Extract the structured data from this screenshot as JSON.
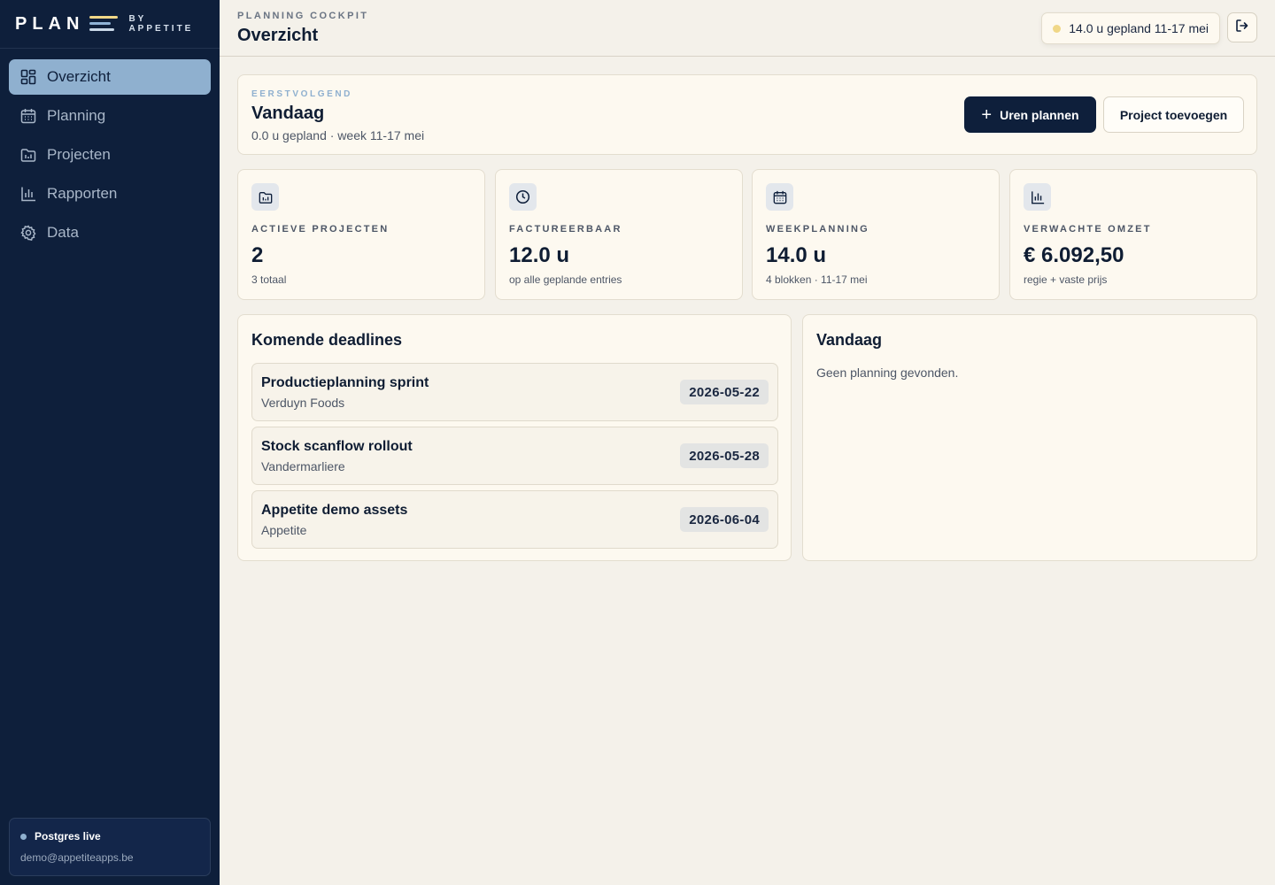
{
  "brand": {
    "name": "PLAN",
    "by_line1": "BY",
    "by_line2": "APPETITE"
  },
  "sidebar": {
    "items": [
      {
        "label": "Overzicht",
        "icon": "dashboard-icon",
        "active": true
      },
      {
        "label": "Planning",
        "icon": "calendar-icon",
        "active": false
      },
      {
        "label": "Projecten",
        "icon": "folder-icon",
        "active": false
      },
      {
        "label": "Rapporten",
        "icon": "bar-chart-icon",
        "active": false
      },
      {
        "label": "Data",
        "icon": "gear-icon",
        "active": false
      }
    ],
    "db_status": "Postgres live",
    "user_email": "demo@appetiteapps.be"
  },
  "header": {
    "eyebrow": "PLANNING COCKPIT",
    "title": "Overzicht",
    "week_summary": "14.0 u gepland 11-17 mei",
    "logout_icon": "logout-icon"
  },
  "focus": {
    "eyebrow": "EERSTVOLGEND",
    "title": "Vandaag",
    "subtitle": "0.0 u gepland · week 11-17 mei",
    "primary_button": "Uren plannen",
    "secondary_button": "Project toevoegen"
  },
  "stats": [
    {
      "label": "ACTIEVE PROJECTEN",
      "value": "2",
      "sub": "3 totaal",
      "icon": "folder-icon"
    },
    {
      "label": "FACTUREERBAAR",
      "value": "12.0 u",
      "sub": "op alle geplande entries",
      "icon": "clock-icon"
    },
    {
      "label": "WEEKPLANNING",
      "value": "14.0 u",
      "sub": "4 blokken · 11-17 mei",
      "icon": "calendar-icon"
    },
    {
      "label": "VERWACHTE OMZET",
      "value": "€ 6.092,50",
      "sub": "regie + vaste prijs",
      "icon": "bar-chart-icon"
    }
  ],
  "deadlines": {
    "title": "Komende deadlines",
    "items": [
      {
        "name": "Productieplanning sprint",
        "client": "Verduyn Foods",
        "date": "2026-05-22"
      },
      {
        "name": "Stock scanflow rollout",
        "client": "Vandermarliere",
        "date": "2026-05-28"
      },
      {
        "name": "Appetite demo assets",
        "client": "Appetite",
        "date": "2026-06-04"
      }
    ]
  },
  "today": {
    "title": "Vandaag",
    "empty_text": "Geen planning gevonden."
  },
  "colors": {
    "sidebar_bg": "#0e1f3b",
    "active_nav": "#8fb0cf",
    "accent_yellow": "#f0d787",
    "page_bg": "#f4f1ea",
    "card_bg": "#fdf9f0"
  }
}
